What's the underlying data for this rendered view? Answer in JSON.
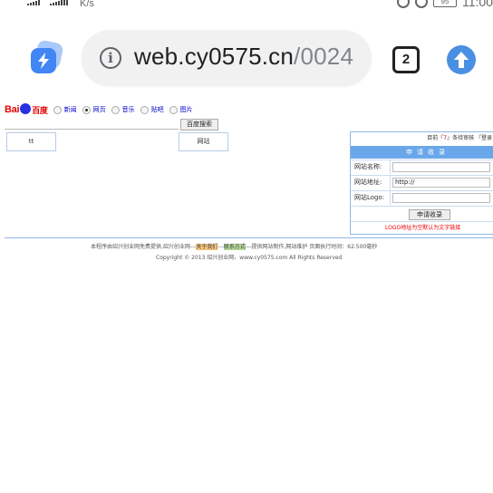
{
  "status": {
    "speed": "K/s",
    "time": "11:00",
    "battery": "95"
  },
  "browser": {
    "url_domain": "web.cy0575.cn",
    "url_path": "/0024",
    "tab_count": "2"
  },
  "search": {
    "logo_text": "Bai",
    "logo_text2": "百度",
    "radios": [
      {
        "label": "新闻",
        "checked": false
      },
      {
        "label": "网页",
        "checked": true
      },
      {
        "label": "音乐",
        "checked": false
      },
      {
        "label": "贴吧",
        "checked": false
      },
      {
        "label": "图片",
        "checked": false
      }
    ],
    "button": "百度搜索"
  },
  "boxes": {
    "tt": "tt",
    "site": "网站"
  },
  "panel": {
    "top_prefix": "目前『",
    "top_count": "7",
    "top_suffix": "』条待审核 『登录",
    "heading": "申请收录",
    "fields": [
      {
        "label": "网站名称:",
        "value": ""
      },
      {
        "label": "网站地址:",
        "value": "http://"
      },
      {
        "label": "网站Logo:",
        "value": ""
      }
    ],
    "submit": "申请收录",
    "note": "LOGO地址为空默认为文字链接"
  },
  "footer": {
    "line1_a": "本程序由绍兴创业网免费提供,绍兴创业网---",
    "about": "关于我们",
    "sep": "---",
    "contact": "联系方式",
    "line1_b": "---提供网站制作,网站维护   页面执行时间：62.500毫秒",
    "line2": "Copyright © 2013 绍兴创业网、www.cy0575.com All Rights Reserved"
  },
  "colors": {
    "accent_blue": "#6aa7ea",
    "logo_red": "#e10602",
    "warning_red": "#e00000"
  }
}
